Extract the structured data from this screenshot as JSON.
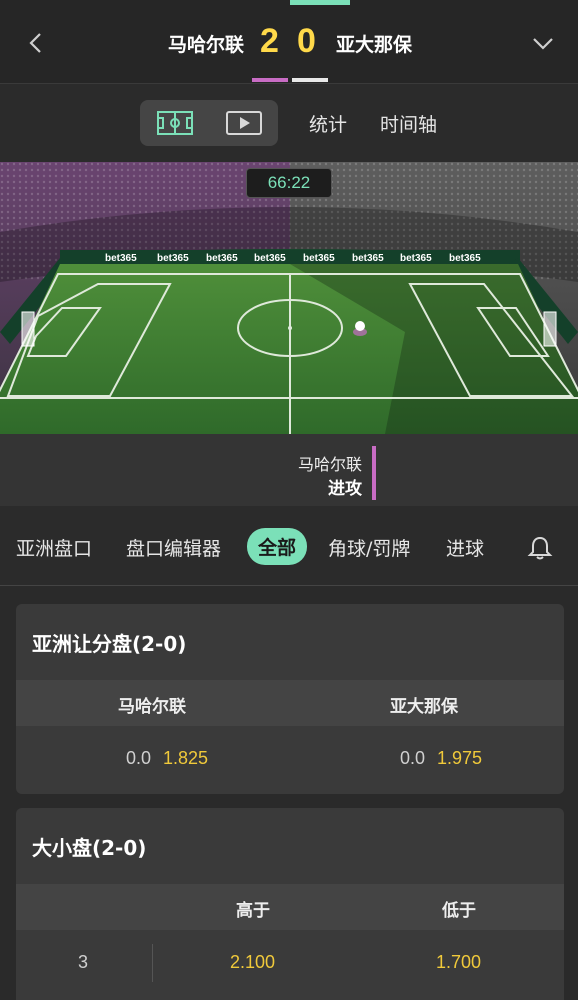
{
  "header": {
    "home_team": "马哈尔联",
    "away_team": "亚大那保",
    "home_score": "2",
    "away_score": "0"
  },
  "toolbar": {
    "stats_label": "统计",
    "timeline_label": "时间轴"
  },
  "match": {
    "clock": "66:22",
    "attack_team": "马哈尔联",
    "attack_action": "进攻",
    "board_text": "bet365"
  },
  "tabs": [
    {
      "label": "亚洲盘口"
    },
    {
      "label": "盘口编辑器"
    },
    {
      "label": "全部",
      "active": true
    },
    {
      "label": "角球/罚牌"
    },
    {
      "label": "进球"
    }
  ],
  "markets": {
    "handicap": {
      "title": "亚洲让分盘(2-0)",
      "home": "马哈尔联",
      "away": "亚大那保",
      "home_line": "0.0",
      "home_price": "1.825",
      "away_line": "0.0",
      "away_price": "1.975"
    },
    "total": {
      "title": "大小盘(2-0)",
      "over_label": "高于",
      "under_label": "低于",
      "line": "3",
      "over_price": "2.100",
      "under_price": "1.700"
    }
  },
  "colors": {
    "accent": "#7be0b8",
    "home": "#c86cc4",
    "price": "#f0c93a",
    "score": "#ffd94a"
  }
}
